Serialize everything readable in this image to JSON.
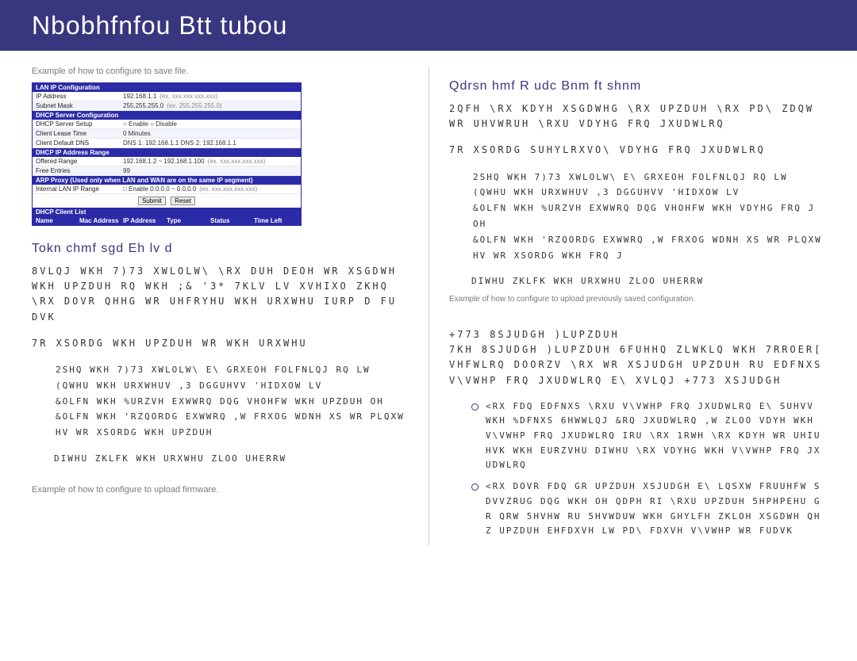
{
  "header": {
    "title": "Nbobhfnfou   Btt  tubou"
  },
  "left": {
    "caption1": "Example of how to configure to save file.",
    "cfg": {
      "sec1": "LAN IP Configuration",
      "ip_lbl": "IP Address",
      "ip_val": "192.168.1.1",
      "ip_hint": "(ex. xxx.xxx.xxx.xxx)",
      "mask_lbl": "Subnet Mask",
      "mask_val": "255.255.255.0",
      "mask_hint": "(ex. 255.255.255.0)",
      "sec2": "DHCP Server Configuration",
      "dhcp_lbl": "DHCP Server Setup",
      "dhcp_val": "○ Enable  ○ Disable",
      "lease_lbl": "Client Lease Time",
      "lease_val": "0     Minutes",
      "dns_lbl": "Client Default DNS",
      "dns_val": "DNS 1: 192.168.1.1    DNS 2: 192.168.1.1",
      "sec3": "DHCP IP Address Range",
      "range_lbl": "Offered Range",
      "range_val": "192.168.1.2  ~ 192.168.1.100",
      "range_hint": "(ex. xxx.xxx.xxx.xxx)",
      "free_lbl": "Free Entries",
      "free_val": "99",
      "sec4": "ARP Proxy (Used only when LAN and WAN are on the same IP segment)",
      "arp_lbl": "Internal LAN IP Range",
      "arp_val": "□ Enable 0.0.0.0   ~ 0.0.0.0",
      "arp_hint": "(ex. xxx.xxx.xxx.xxx)",
      "submit": "Submit",
      "reset": "Reset",
      "sec5": "DHCP Client List",
      "c1": "Name",
      "c2": "Mac Address",
      "c3": "IP Address",
      "c4": "Type",
      "c5": "Status",
      "c6": "Time Left"
    },
    "section_title": "Tokn  chmf  sgd  Eh  lv  d",
    "para1": "8VLQJ WKH 7)73 XWLOLW\\ \\RX DUH DEOH WR XSGDWH WKH  UPZDUH RQ WKH ;& '3* 7KLV LV XVHIXO ZKHQ \\RX DOVR QHHG WR UHFRYHU WKH URXWHU IURP D FUDVK",
    "para2": "7R XSORDG WKH  UPZDUH WR WKH URXWHU",
    "steps": [
      "2SHQ WKH 7)73 XWLOLW\\ E\\ GRXEOH FOLFNLQJ RQ LW",
      "(QWHU WKH URXWHUV ,3 DGGUHVV 'HIDXOW LV",
      "&OLFN WKH %URZVH EXWWRQ DQG VHOHFW WKH  UPZDUH  OH",
      "&OLFN WKH 'RZQORDG EXWWRQ ,W FRXOG WDNH XS WR   PLQXWHV WR XSORDG WKH  UPZDUH"
    ],
    "after": "DIWHU ZKLFK WKH URXWHU ZLOO UHERRW",
    "caption2": "Example of how to configure to upload firmware."
  },
  "right": {
    "section_title": "Qdrsn  hmf  R  udc  Bnm  ft  shnm",
    "para1": "2QFH \\RX KDYH XSGDWHG \\RX  UPZDUH \\RX PD\\ ZDQW WR UHVWRUH \\RXU VDYHG FRQ JXUDWLRQ",
    "para2": "7R XSORDG SUHYLRXVO\\ VDYHG FRQ JXUDWLRQ",
    "steps": [
      "2SHQ WKH 7)73 XWLOLW\\ E\\ GRXEOH FOLFNLQJ RQ LW",
      "(QWHU WKH URXWHUV ,3 DGGUHVV 'HIDXOW LV",
      "&OLFN WKH %URZVH EXWWRQ DQG VHOHFW WKH VDYHG FRQ J  OH",
      "&OLFN WKH 'RZQORDG EXWWRQ ,W FRXOG WDNH XS WR   PLQXWHV WR XSORDG WKH FRQ J"
    ],
    "after": "DIWHU ZKLFK WKH URXWHU ZLOO UHERRW",
    "overlay": "Example of how to configure to upload previously saved configuration.",
    "http_title": "+773 8SJUDGH )LUPZDUH",
    "http_body": "7KH 8SJUDGH )LUPZDUH 6FUHHQ ZLWKLQ WKH 7RROER[ VHFWLRQ DOORZV \\RX WR XSJUDGH  UPZDUH RU EDFNXS V\\VWHP FRQ JXUDWLRQ E\\ XVLQJ +773 XSJUDGH",
    "bullets": [
      "<RX FDQ EDFNXS \\RXU V\\VWHP FRQ JXUDWLRQ E\\ SUHVV WKH %DFNXS 6HWWLQJ &RQ JXUDWLRQ ,W ZLOO VDYH WKH V\\VWHP FRQ JXUDWLRQ IRU \\RX  1RWH \\RX KDYH WR UHIUHVK WKH EURZVHU DIWHU \\RX VDYHG WKH V\\VWHP FRQ JXUDWLRQ",
      "<RX DOVR FDQ GR  UPZDUH XSJUDGH E\\ LQSXW FRUUHFW SDVVZRUG DQG WKH  OH QDPH RI \\RXU  UPZDUH  5HPHPEHU GR QRW 5HVHW RU 5HVWDUW WKH GHYLFH ZKLOH XSGDWH QHZ  UPZDUH EHFDXVH LW PD\\ FDXVH V\\VWHP WR FUDVK"
    ]
  }
}
